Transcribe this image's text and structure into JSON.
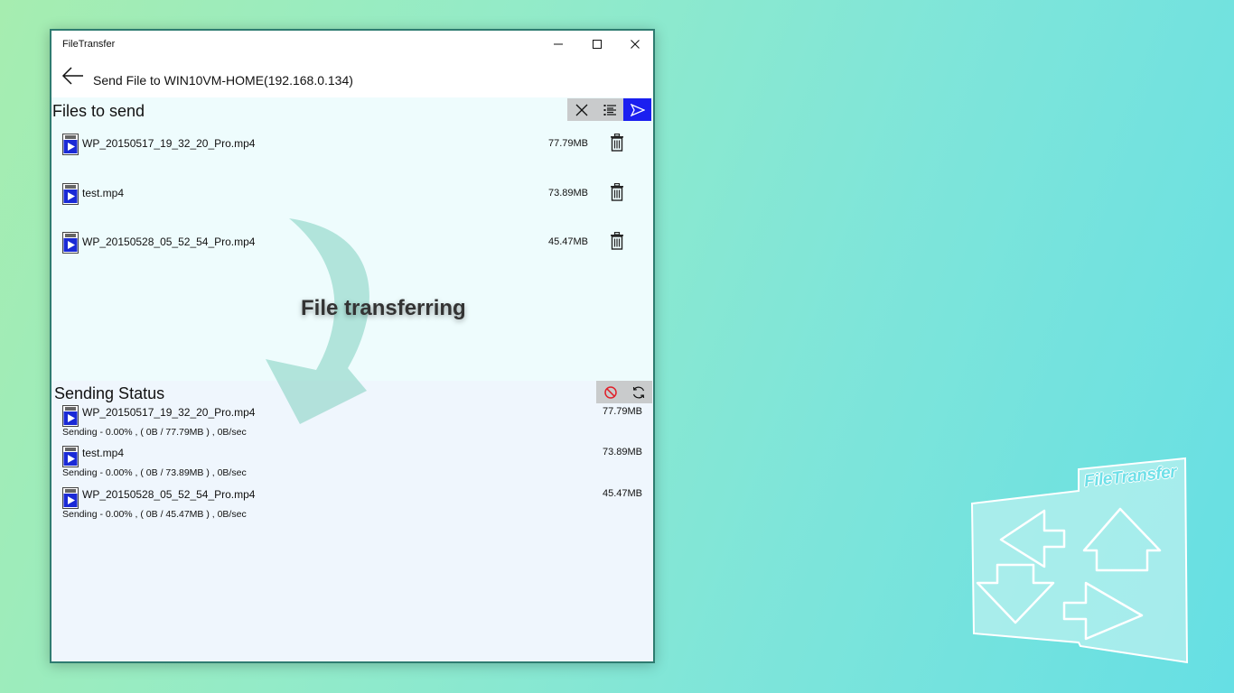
{
  "window": {
    "app_title": "FileTransfer",
    "controls": {
      "minimize": "minimize-icon",
      "maximize": "maximize-icon",
      "close": "close-icon"
    }
  },
  "header": {
    "back_icon": "back-arrow-icon",
    "title": "Send File to WIN10VM-HOME(192.168.0.134)"
  },
  "files_to_send": {
    "title": "Files to send",
    "toolbar": [
      "clear-icon",
      "select-list-icon",
      "send-icon"
    ],
    "accent_color": "#1b1ff0",
    "files": [
      {
        "name": "WP_20150517_19_32_20_Pro.mp4",
        "size": "77.79MB"
      },
      {
        "name": "test.mp4",
        "size": "73.89MB"
      },
      {
        "name": "WP_20150528_05_52_54_Pro.mp4",
        "size": "45.47MB"
      }
    ]
  },
  "sending_status": {
    "title": "Sending Status",
    "toolbar": [
      "cancel-icon",
      "refresh-icon"
    ],
    "items": [
      {
        "name": "WP_20150517_19_32_20_Pro.mp4",
        "size": "77.79MB",
        "detail": "Sending - 0.00% , ( 0B / 77.79MB ) , 0B/sec"
      },
      {
        "name": "test.mp4",
        "size": "73.89MB",
        "detail": "Sending - 0.00% , ( 0B / 73.89MB ) , 0B/sec"
      },
      {
        "name": "WP_20150528_05_52_54_Pro.mp4",
        "size": "45.47MB",
        "detail": "Sending - 0.00% , ( 0B / 45.47MB ) , 0B/sec"
      }
    ]
  },
  "overlay": {
    "caption": "File transferring"
  },
  "logo": {
    "text": "FileTransfer"
  }
}
